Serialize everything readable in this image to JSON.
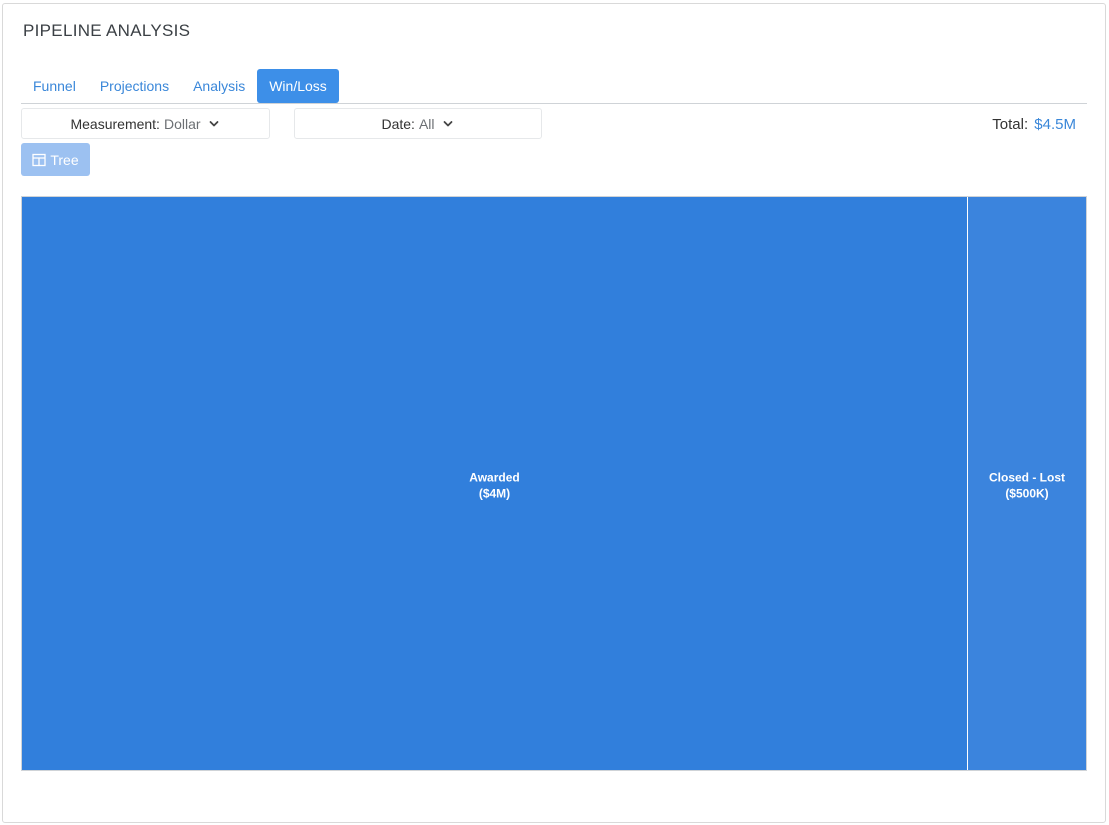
{
  "header": {
    "title": "PIPELINE ANALYSIS"
  },
  "tabs": [
    {
      "label": "Funnel",
      "active": false
    },
    {
      "label": "Projections",
      "active": false
    },
    {
      "label": "Analysis",
      "active": false
    },
    {
      "label": "Win/Loss",
      "active": true
    }
  ],
  "filters": {
    "measurement": {
      "label": "Measurement:",
      "value": "Dollar"
    },
    "date": {
      "label": "Date:",
      "value": "All"
    }
  },
  "total": {
    "label": "Total:",
    "value": "$4.5M"
  },
  "view_button": {
    "label": "Tree",
    "icon": "table-icon"
  },
  "colors": {
    "accent": "#3d8fe8",
    "link": "#3a87d9",
    "button_disabled": "#9cc1f1",
    "cell_awarded": "#317fdc",
    "cell_lost": "#3b84dd"
  },
  "chart_data": {
    "type": "treemap",
    "nodes": [
      {
        "name": "Awarded",
        "label": "($4M)",
        "value": 4000000,
        "color": "#317fdc"
      },
      {
        "name": "Closed - Lost",
        "label": "($500K)",
        "value": 500000,
        "color": "#3b84dd"
      }
    ]
  }
}
